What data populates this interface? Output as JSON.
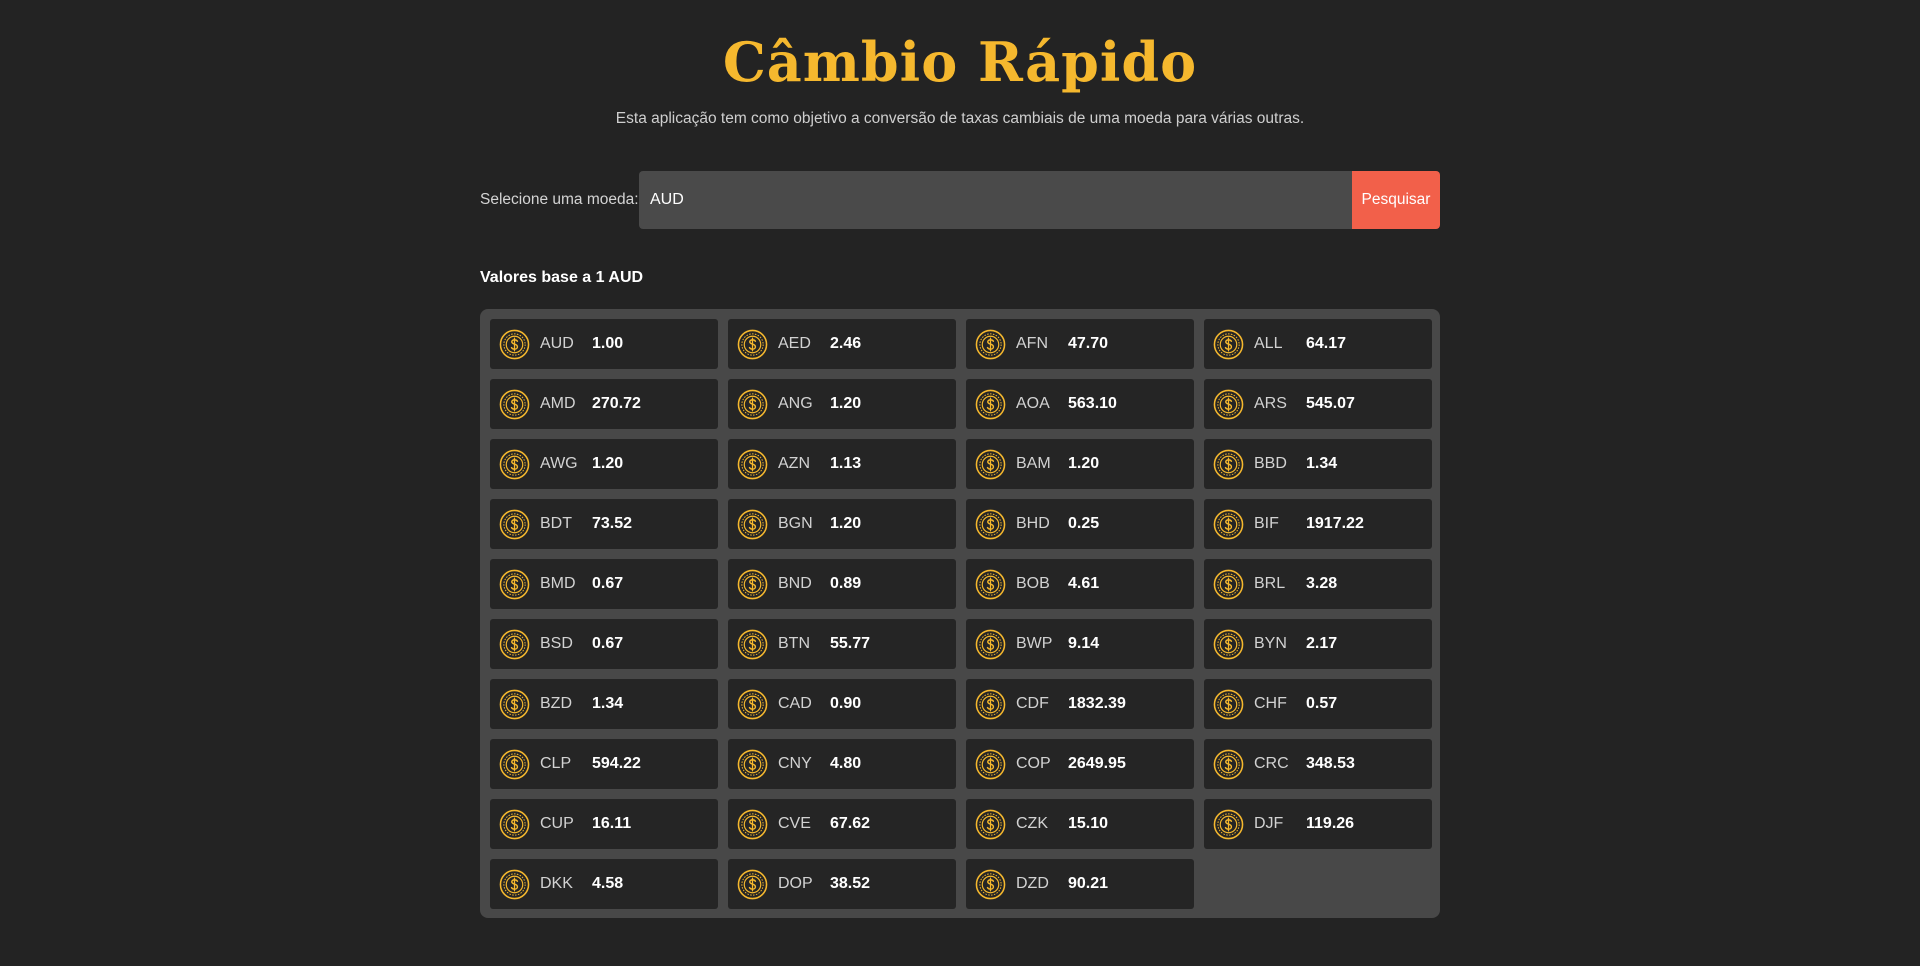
{
  "header": {
    "title": "Câmbio Rápido",
    "subtitle": "Esta aplicação tem como objetivo a conversão de taxas cambiais de uma moeda para várias outras."
  },
  "search": {
    "label": "Selecione uma moeda:",
    "value": "AUD",
    "button_label": "Pesquisar"
  },
  "results": {
    "heading": "Valores base a 1 AUD",
    "coin_icon": "dollar-coin-icon",
    "items": [
      {
        "code": "AUD",
        "value": "1.00"
      },
      {
        "code": "AED",
        "value": "2.46"
      },
      {
        "code": "AFN",
        "value": "47.70"
      },
      {
        "code": "ALL",
        "value": "64.17"
      },
      {
        "code": "AMD",
        "value": "270.72"
      },
      {
        "code": "ANG",
        "value": "1.20"
      },
      {
        "code": "AOA",
        "value": "563.10"
      },
      {
        "code": "ARS",
        "value": "545.07"
      },
      {
        "code": "AWG",
        "value": "1.20"
      },
      {
        "code": "AZN",
        "value": "1.13"
      },
      {
        "code": "BAM",
        "value": "1.20"
      },
      {
        "code": "BBD",
        "value": "1.34"
      },
      {
        "code": "BDT",
        "value": "73.52"
      },
      {
        "code": "BGN",
        "value": "1.20"
      },
      {
        "code": "BHD",
        "value": "0.25"
      },
      {
        "code": "BIF",
        "value": "1917.22"
      },
      {
        "code": "BMD",
        "value": "0.67"
      },
      {
        "code": "BND",
        "value": "0.89"
      },
      {
        "code": "BOB",
        "value": "4.61"
      },
      {
        "code": "BRL",
        "value": "3.28"
      },
      {
        "code": "BSD",
        "value": "0.67"
      },
      {
        "code": "BTN",
        "value": "55.77"
      },
      {
        "code": "BWP",
        "value": "9.14"
      },
      {
        "code": "BYN",
        "value": "2.17"
      },
      {
        "code": "BZD",
        "value": "1.34"
      },
      {
        "code": "CAD",
        "value": "0.90"
      },
      {
        "code": "CDF",
        "value": "1832.39"
      },
      {
        "code": "CHF",
        "value": "0.57"
      },
      {
        "code": "CLP",
        "value": "594.22"
      },
      {
        "code": "CNY",
        "value": "4.80"
      },
      {
        "code": "COP",
        "value": "2649.95"
      },
      {
        "code": "CRC",
        "value": "348.53"
      },
      {
        "code": "CUP",
        "value": "16.11"
      },
      {
        "code": "CVE",
        "value": "67.62"
      },
      {
        "code": "CZK",
        "value": "15.10"
      },
      {
        "code": "DJF",
        "value": "119.26"
      },
      {
        "code": "DKK",
        "value": "4.58"
      },
      {
        "code": "DOP",
        "value": "38.52"
      },
      {
        "code": "DZD",
        "value": "90.21"
      }
    ]
  },
  "colors": {
    "background": "#232323",
    "accent_gold": "#f5b82e",
    "button": "#f2604a",
    "panel": "#484848",
    "card": "#252525"
  }
}
